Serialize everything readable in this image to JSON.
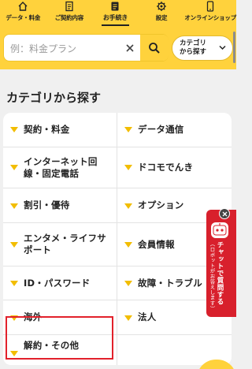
{
  "nav": {
    "items": [
      {
        "label": "データ・料金",
        "icon": "home-icon"
      },
      {
        "label": "ご契約内容",
        "icon": "contract-icon"
      },
      {
        "label": "お手続き",
        "icon": "procedure-icon",
        "active": true
      },
      {
        "label": "設定",
        "icon": "gear-icon"
      },
      {
        "label": "オンラインショップ",
        "icon": "phone-icon"
      }
    ]
  },
  "search": {
    "placeholder": "例：料金プラン",
    "category_button": "カテゴリ\nから探す"
  },
  "section": {
    "title": "カテゴリから探す"
  },
  "categories": [
    {
      "left": "契約・料金",
      "right": "データ通信"
    },
    {
      "left": "インターネット回\n線・固定電話",
      "right": "ドコモでんき"
    },
    {
      "left": "割引・優待",
      "right": "オプション"
    },
    {
      "left": "エンタメ・ライフサ\nポート",
      "right": "会員情報"
    },
    {
      "left": "ID・パスワード",
      "right": "故障・トラブル"
    },
    {
      "left": "海外",
      "right": "法人"
    },
    {
      "left": "解約・その他",
      "right": ""
    }
  ],
  "chat": {
    "title": "チャットで質問する",
    "subtitle": "（ロボットがお答えします）"
  },
  "colors": {
    "brand_yellow": "#ffd23c",
    "triangle": "#f2bd00",
    "chat_red": "#d8202c",
    "highlight_red": "#e2212b"
  }
}
